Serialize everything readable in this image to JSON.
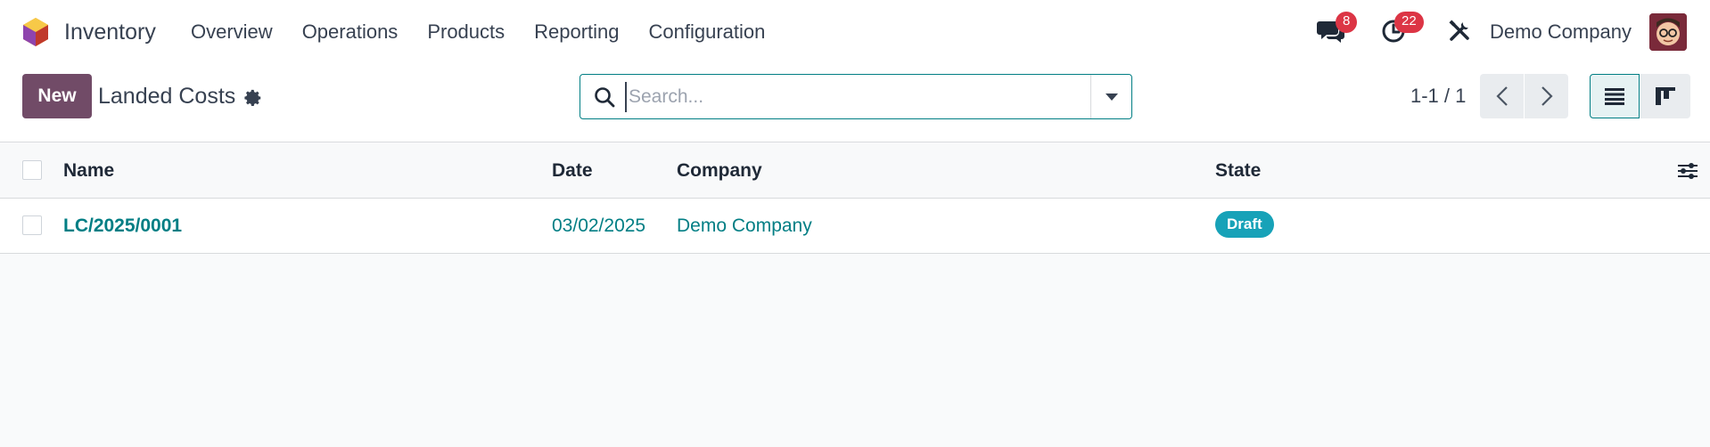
{
  "navbar": {
    "app_name": "Inventory",
    "menu": [
      "Overview",
      "Operations",
      "Products",
      "Reporting",
      "Configuration"
    ],
    "messages_count": "8",
    "activities_count": "22",
    "company": "Demo Company",
    "icons": [
      "odoo-logo-icon",
      "chat-icon",
      "clock-icon",
      "tools-icon",
      "avatar"
    ]
  },
  "control_panel": {
    "new_label": "New",
    "title": "Landed Costs",
    "search_placeholder": "Search...",
    "pager": "1-1 / 1"
  },
  "list": {
    "columns": [
      "Name",
      "Date",
      "Company",
      "State"
    ],
    "rows": [
      {
        "name": "LC/2025/0001",
        "date": "03/02/2025",
        "company": "Demo Company",
        "state": "Draft"
      }
    ]
  },
  "colors": {
    "primary": "#714b67",
    "link": "#017e84",
    "badge_red": "#dc3545",
    "state_draft": "#17a2b8"
  }
}
